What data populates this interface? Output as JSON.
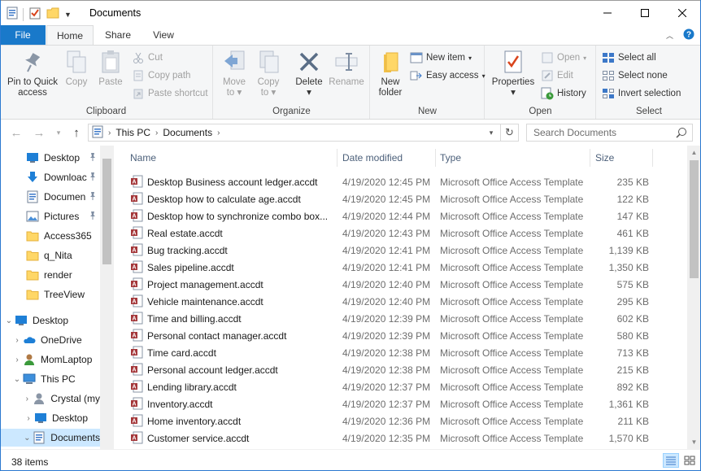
{
  "window": {
    "title": "Documents"
  },
  "tabs": {
    "file": "File",
    "home": "Home",
    "share": "Share",
    "view": "View"
  },
  "ribbon": {
    "clipboard": {
      "label": "Clipboard",
      "pin_line1": "Pin to Quick",
      "pin_line2": "access",
      "copy": "Copy",
      "paste": "Paste",
      "cut": "Cut",
      "copy_path": "Copy path",
      "paste_shortcut": "Paste shortcut"
    },
    "organize": {
      "label": "Organize",
      "move_to_1": "Move",
      "move_to_2": "to",
      "copy_to_1": "Copy",
      "copy_to_2": "to",
      "delete": "Delete",
      "rename": "Rename"
    },
    "new": {
      "label": "New",
      "new_folder_1": "New",
      "new_folder_2": "folder",
      "new_item": "New item",
      "easy_access": "Easy access"
    },
    "open": {
      "label": "Open",
      "properties": "Properties",
      "open": "Open",
      "edit": "Edit",
      "history": "History"
    },
    "select": {
      "label": "Select",
      "select_all": "Select all",
      "select_none": "Select none",
      "invert": "Invert selection"
    }
  },
  "address": {
    "crumbs": [
      "This PC",
      "Documents"
    ],
    "search_placeholder": "Search Documents"
  },
  "nav": {
    "quick": [
      {
        "label": "Desktop",
        "pinned": true
      },
      {
        "label": "Downloac",
        "pinned": true
      },
      {
        "label": "Documen",
        "pinned": true
      },
      {
        "label": "Pictures",
        "pinned": true
      },
      {
        "label": "Access365",
        "pinned": false
      },
      {
        "label": "q_Nita",
        "pinned": false
      },
      {
        "label": "render",
        "pinned": false
      },
      {
        "label": "TreeView",
        "pinned": false
      }
    ],
    "tree": [
      {
        "label": "Desktop"
      },
      {
        "label": "OneDrive"
      },
      {
        "label": "MomLaptop"
      },
      {
        "label": "This PC"
      },
      {
        "label": "Crystal (my"
      },
      {
        "label": "Desktop"
      },
      {
        "label": "Documents"
      }
    ]
  },
  "columns": {
    "name": "Name",
    "date": "Date modified",
    "type": "Type",
    "size": "Size"
  },
  "files": [
    {
      "name": "Desktop Business account ledger.accdt",
      "date": "4/19/2020 12:45 PM",
      "type": "Microsoft Office Access Template",
      "size": "235 KB"
    },
    {
      "name": "Desktop how to calculate age.accdt",
      "date": "4/19/2020 12:45 PM",
      "type": "Microsoft Office Access Template",
      "size": "122 KB"
    },
    {
      "name": "Desktop how to synchronize combo box...",
      "date": "4/19/2020 12:44 PM",
      "type": "Microsoft Office Access Template",
      "size": "147 KB"
    },
    {
      "name": "Real estate.accdt",
      "date": "4/19/2020 12:43 PM",
      "type": "Microsoft Office Access Template",
      "size": "461 KB"
    },
    {
      "name": "Bug tracking.accdt",
      "date": "4/19/2020 12:41 PM",
      "type": "Microsoft Office Access Template",
      "size": "1,139 KB"
    },
    {
      "name": "Sales pipeline.accdt",
      "date": "4/19/2020 12:41 PM",
      "type": "Microsoft Office Access Template",
      "size": "1,350 KB"
    },
    {
      "name": "Project management.accdt",
      "date": "4/19/2020 12:40 PM",
      "type": "Microsoft Office Access Template",
      "size": "575 KB"
    },
    {
      "name": "Vehicle maintenance.accdt",
      "date": "4/19/2020 12:40 PM",
      "type": "Microsoft Office Access Template",
      "size": "295 KB"
    },
    {
      "name": "Time and billing.accdt",
      "date": "4/19/2020 12:39 PM",
      "type": "Microsoft Office Access Template",
      "size": "602 KB"
    },
    {
      "name": "Personal contact manager.accdt",
      "date": "4/19/2020 12:39 PM",
      "type": "Microsoft Office Access Template",
      "size": "580 KB"
    },
    {
      "name": "Time card.accdt",
      "date": "4/19/2020 12:38 PM",
      "type": "Microsoft Office Access Template",
      "size": "713 KB"
    },
    {
      "name": "Personal account ledger.accdt",
      "date": "4/19/2020 12:38 PM",
      "type": "Microsoft Office Access Template",
      "size": "215 KB"
    },
    {
      "name": "Lending library.accdt",
      "date": "4/19/2020 12:37 PM",
      "type": "Microsoft Office Access Template",
      "size": "892 KB"
    },
    {
      "name": "Inventory.accdt",
      "date": "4/19/2020 12:37 PM",
      "type": "Microsoft Office Access Template",
      "size": "1,361 KB"
    },
    {
      "name": "Home inventory.accdt",
      "date": "4/19/2020 12:36 PM",
      "type": "Microsoft Office Access Template",
      "size": "211 KB"
    },
    {
      "name": "Customer service.accdt",
      "date": "4/19/2020 12:35 PM",
      "type": "Microsoft Office Access Template",
      "size": "1,570 KB"
    }
  ],
  "status": {
    "count": "38 items"
  },
  "colors": {
    "accent": "#1979ca",
    "selection": "#cce8ff",
    "header_text": "#4c607a"
  }
}
